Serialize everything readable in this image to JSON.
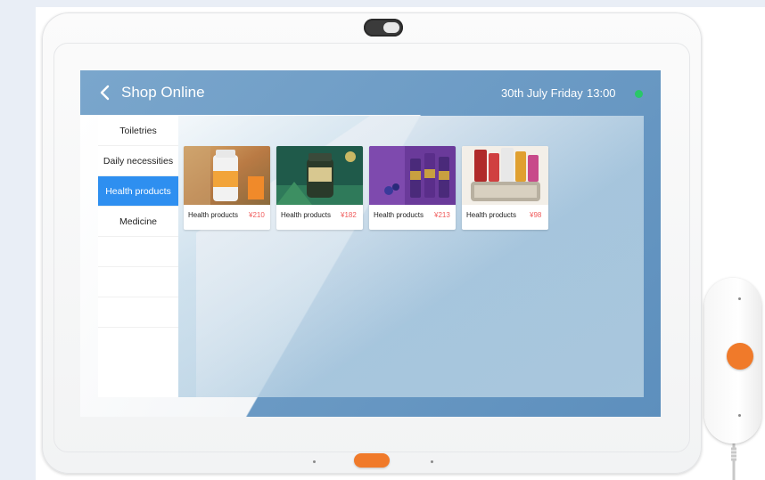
{
  "header": {
    "back_icon": "chevron-left-icon",
    "title": "Shop Online",
    "date": "30th July Friday",
    "time": "13:00",
    "status_color": "#29c768"
  },
  "sidebar": {
    "items": [
      {
        "label": "Toiletries",
        "active": false
      },
      {
        "label": "Daily necessities",
        "active": false
      },
      {
        "label": "Health products",
        "active": true
      },
      {
        "label": "Medicine",
        "active": false
      }
    ]
  },
  "products": [
    {
      "label": "Health products",
      "price": "¥210"
    },
    {
      "label": "Health products",
      "price": "¥182"
    },
    {
      "label": "Health products",
      "price": "¥213"
    },
    {
      "label": "Health products",
      "price": "¥98"
    }
  ],
  "colors": {
    "accent": "#2e8ff0",
    "price": "#f05a5a",
    "device_button": "#f07a2a",
    "header_bg": "#6f9ec7"
  }
}
